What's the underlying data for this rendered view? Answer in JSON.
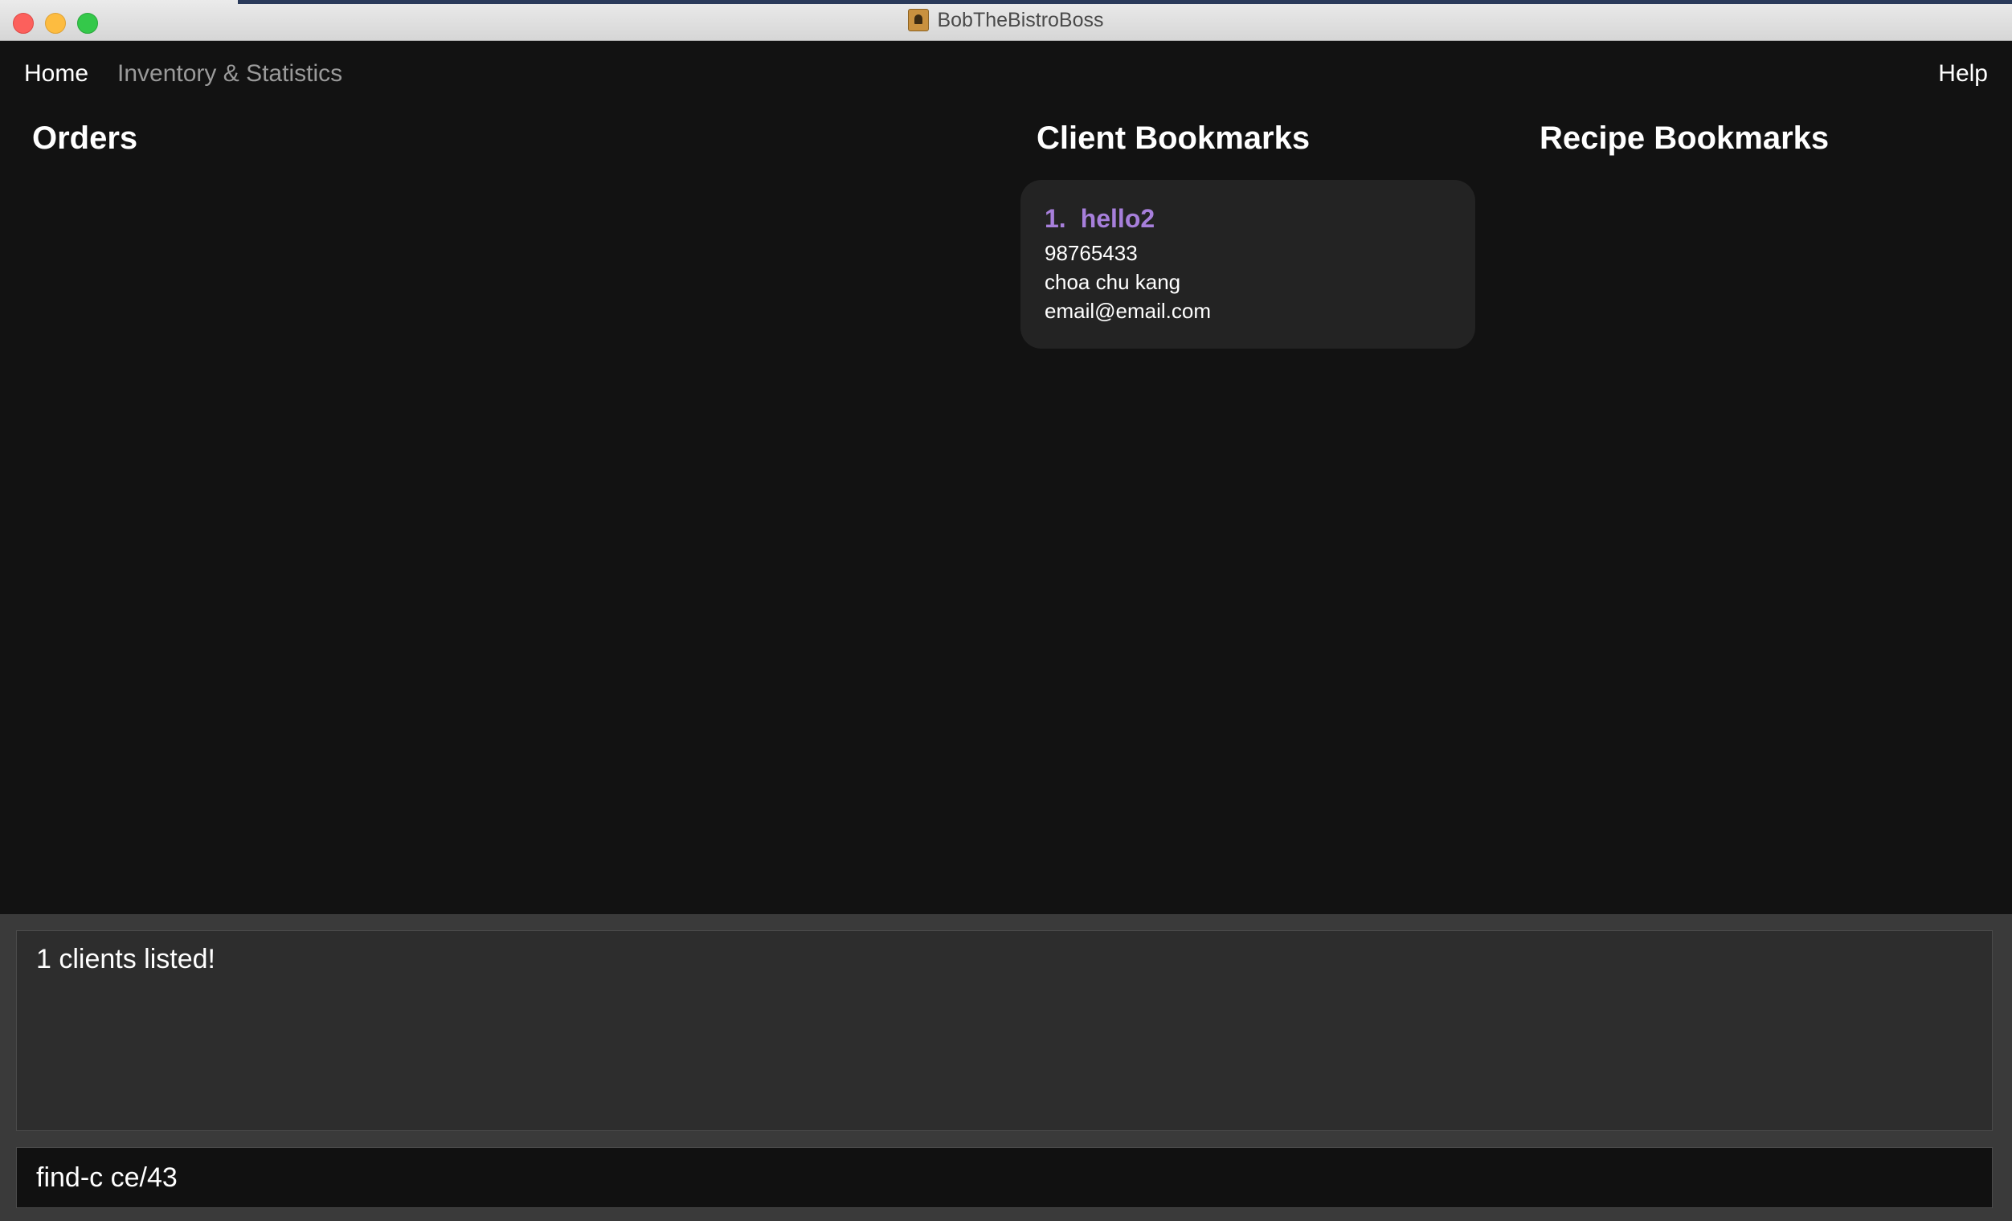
{
  "window": {
    "title": "BobTheBistroBoss",
    "app_icon": "contact-book-icon"
  },
  "menu": {
    "home": "Home",
    "inventory": "Inventory & Statistics",
    "help": "Help"
  },
  "sections": {
    "orders": "Orders",
    "client_bookmarks": "Client Bookmarks",
    "recipe_bookmarks": "Recipe Bookmarks"
  },
  "client_bookmarks": [
    {
      "index": "1.",
      "name": "hello2",
      "phone": "98765433",
      "address": "choa chu kang",
      "email": "email@email.com"
    }
  ],
  "result_display": {
    "text": "1 clients listed!"
  },
  "command_box": {
    "value": "find-c ce/43"
  },
  "colors": {
    "background": "#121212",
    "card": "#232323",
    "accent_name": "#a77fdb",
    "inactive_menu": "#9a9a9a"
  }
}
